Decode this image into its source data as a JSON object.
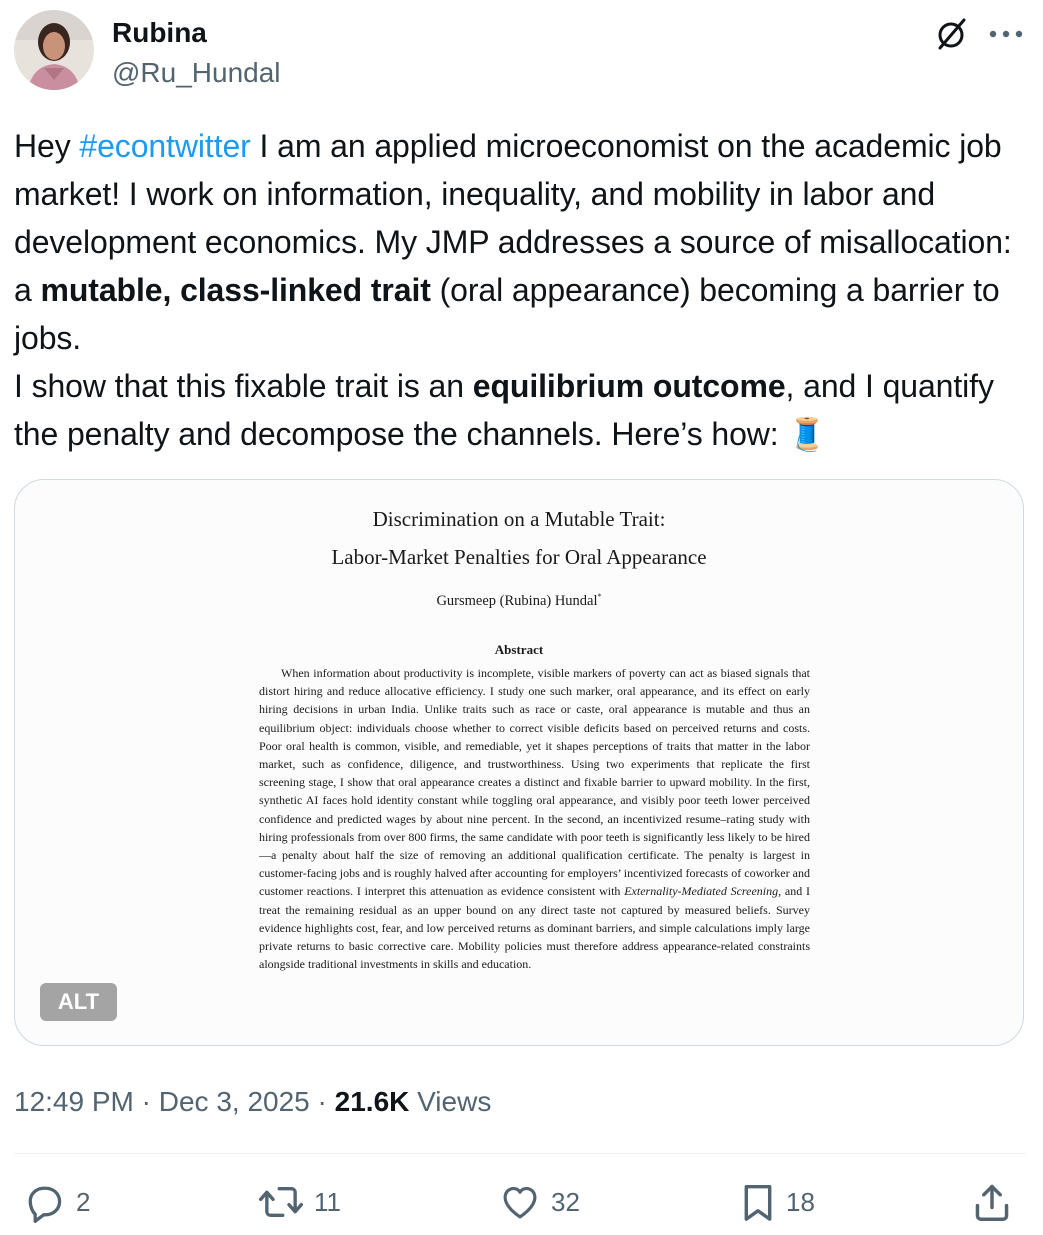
{
  "user": {
    "display_name": "Rubina",
    "handle": "@Ru_Hundal"
  },
  "tweet": {
    "line1_hashtag": "#econtwitter",
    "line1_rest": "  I am an applied microeconomist on the academic job market! I work on information, inequality, and mobility in labor and development economics.  My JMP addresses a source of misallocation: a ",
    "intro": "Hey ",
    "bold1": "mutable, class-linked trait",
    "after_bold1": " (oral appearance) becoming a barrier to jobs.",
    "p2_before": "I show that this fixable trait is an ",
    "bold2": "equilibrium outcome",
    "p2_after": ", and I quantify the penalty and decompose the channels. Here’s how: ",
    "emoji": "🧵"
  },
  "media": {
    "title_line1": "Discrimination on a Mutable Trait:",
    "title_line2": "Labor-Market Penalties for Oral Appearance",
    "author": "Gursmeep (Rubina) Hundal",
    "author_mark": "*",
    "abstract_heading": "Abstract",
    "abstract_part1": "When information about productivity is incomplete, visible markers of poverty can act as biased signals that distort hiring and reduce allocative efficiency. I study one such marker, oral appearance, and its effect on early hiring decisions in urban India. Unlike traits such as race or caste, oral appearance is mutable and thus an equilibrium object: individuals choose whether to correct visible deficits based on perceived returns and costs. Poor oral health is common, visible, and remediable, yet it shapes perceptions of traits that matter in the labor market, such as confidence, diligence, and trustworthiness.  Using two experiments that replicate the first screening stage, I show that oral appearance creates a distinct and fixable barrier to upward mobility. In the first, synthetic AI faces hold identity constant while toggling oral appearance, and visibly poor teeth lower perceived confidence and predicted wages by about nine percent. In the second, an incentivized resume–rating study with hiring professionals from over 800 firms, the same candidate with poor teeth is significantly less likely to be hired—a penalty about half the size of removing an additional qualification certificate. The penalty is largest in customer-facing jobs and is roughly halved after accounting for employers’ incentivized forecasts of coworker and customer reactions. I interpret this attenuation as evidence consistent with ",
    "abstract_italic": "Externality-Mediated Screening",
    "abstract_part2": ", and I treat the remaining residual as an upper bound on any direct taste not captured by measured beliefs. Survey evidence highlights cost, fear, and low perceived returns as dominant barriers, and simple calculations imply large private returns to basic corrective care. Mobility policies must therefore address appearance-related constraints alongside traditional investments in skills and education.",
    "alt_label": "ALT"
  },
  "meta": {
    "time": "12:49 PM",
    "sep1": " · ",
    "date": "Dec 3, 2025",
    "sep2": " · ",
    "views_count": "21.6K",
    "views_label": " Views"
  },
  "actions": {
    "replies": "2",
    "reposts": "11",
    "likes": "32",
    "bookmarks": "18"
  },
  "colors": {
    "accent": "#1d9bf0",
    "secondary_text": "#536471",
    "border": "#cfd9de"
  },
  "icons": {
    "grok": "grok-icon",
    "more": "more-icon",
    "reply": "reply-icon",
    "repost": "repost-icon",
    "like": "heart-icon",
    "bookmark": "bookmark-icon",
    "share": "share-icon"
  }
}
